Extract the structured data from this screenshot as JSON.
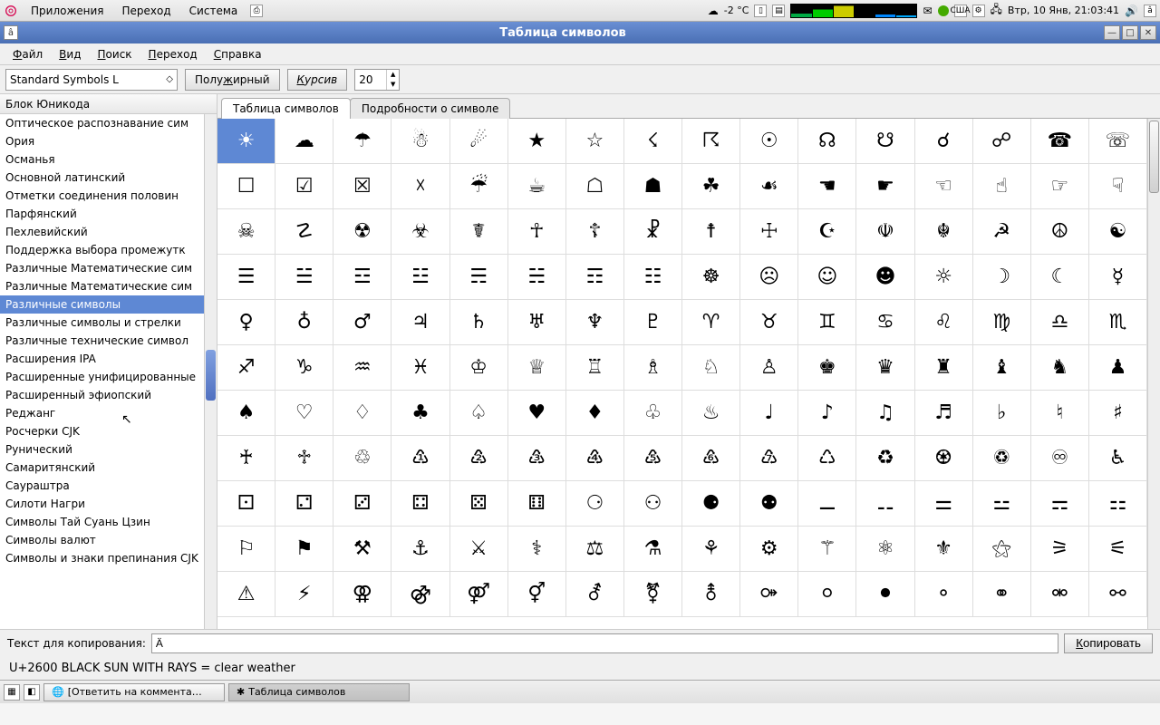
{
  "top_panel": {
    "menus": [
      "Приложения",
      "Переход",
      "Система"
    ],
    "weather": "-2 °C",
    "layout": "США",
    "clock": "Втр, 10 Янв, 21:03:41"
  },
  "window": {
    "title": "Таблица символов"
  },
  "menubar": {
    "items": [
      {
        "u": "Ф",
        "rest": "айл"
      },
      {
        "u": "В",
        "rest": "ид"
      },
      {
        "u": "П",
        "rest": "оиск"
      },
      {
        "u": "П",
        "rest": "ереход"
      },
      {
        "u": "С",
        "rest": "правка"
      }
    ]
  },
  "toolbar": {
    "font": "Standard Symbols L",
    "bold": {
      "pre": "Полу",
      "u": "ж",
      "post": "ирный"
    },
    "italic": {
      "u": "К",
      "post": "урсив"
    },
    "size": "20"
  },
  "sidebar": {
    "header": "Блок Юникода",
    "items": [
      "Оптическое распознавание сим",
      "Ория",
      "Османья",
      "Основной латинский",
      "Отметки соединения половин",
      "Парфянский",
      "Пехлевийский",
      "Поддержка выбора промежутк",
      "Различные Математические сим",
      "Различные Математические сим",
      "Различные символы",
      "Различные символы и стрелки",
      "Различные технические символ",
      "Расширения IPA",
      "Расширенные унифицированные",
      "Расширенный эфиопский",
      "Реджанг",
      "Росчерки CJK",
      "Рунический",
      "Самаритянский",
      "Саураштра",
      "Силоти Нагри",
      "Символы Тай Суань Цзин",
      "Символы валют",
      "Символы и знаки препинания CJK"
    ],
    "selected_index": 10
  },
  "tabs": {
    "items": [
      "Таблица символов",
      "Подробности о символе"
    ],
    "active_index": 0
  },
  "grid": {
    "rows": [
      [
        "☀",
        "☁",
        "☂",
        "☃",
        "☄",
        "★",
        "☆",
        "☇",
        "☈",
        "☉",
        "☊",
        "☋",
        "☌",
        "☍",
        "☎",
        "☏"
      ],
      [
        "☐",
        "☑",
        "☒",
        "☓",
        "☔",
        "☕",
        "☖",
        "☗",
        "☘",
        "☙",
        "☚",
        "☛",
        "☜",
        "☝",
        "☞",
        "☟"
      ],
      [
        "☠",
        "☡",
        "☢",
        "☣",
        "☤",
        "☥",
        "☦",
        "☧",
        "☨",
        "☩",
        "☪",
        "☫",
        "☬",
        "☭",
        "☮",
        "☯"
      ],
      [
        "☰",
        "☱",
        "☲",
        "☳",
        "☴",
        "☵",
        "☶",
        "☷",
        "☸",
        "☹",
        "☺",
        "☻",
        "☼",
        "☽",
        "☾",
        "☿"
      ],
      [
        "♀",
        "♁",
        "♂",
        "♃",
        "♄",
        "♅",
        "♆",
        "♇",
        "♈",
        "♉",
        "♊",
        "♋",
        "♌",
        "♍",
        "♎",
        "♏"
      ],
      [
        "♐",
        "♑",
        "♒",
        "♓",
        "♔",
        "♕",
        "♖",
        "♗",
        "♘",
        "♙",
        "♚",
        "♛",
        "♜",
        "♝",
        "♞",
        "♟"
      ],
      [
        "♠",
        "♡",
        "♢",
        "♣",
        "♤",
        "♥",
        "♦",
        "♧",
        "♨",
        "♩",
        "♪",
        "♫",
        "♬",
        "♭",
        "♮",
        "♯"
      ],
      [
        "♰",
        "♱",
        "♲",
        "♳",
        "♴",
        "♵",
        "♶",
        "♷",
        "♸",
        "♹",
        "♺",
        "♻",
        "♼",
        "♽",
        "♾",
        "♿"
      ],
      [
        "⚀",
        "⚁",
        "⚂",
        "⚃",
        "⚄",
        "⚅",
        "⚆",
        "⚇",
        "⚈",
        "⚉",
        "⚊",
        "⚋",
        "⚌",
        "⚍",
        "⚎",
        "⚏"
      ],
      [
        "⚐",
        "⚑",
        "⚒",
        "⚓",
        "⚔",
        "⚕",
        "⚖",
        "⚗",
        "⚘",
        "⚙",
        "⚚",
        "⚛",
        "⚜",
        "⚝",
        "⚞",
        "⚟"
      ],
      [
        "⚠",
        "⚡",
        "⚢",
        "⚣",
        "⚤",
        "⚥",
        "⚦",
        "⚧",
        "⚨",
        "⚩",
        "⚪",
        "⚫",
        "⚬",
        "⚭",
        "⚮",
        "⚯"
      ]
    ],
    "selected": [
      0,
      0
    ]
  },
  "copy": {
    "label": "Текст для копирования:",
    "value": "Ä",
    "button": {
      "u": "К",
      "post": "опировать"
    }
  },
  "status": "U+2600 BLACK SUN WITH RAYS   = clear weather",
  "taskbar": {
    "tasks": [
      "[Ответить на коммента…",
      "Таблица символов"
    ],
    "active_index": 1
  }
}
